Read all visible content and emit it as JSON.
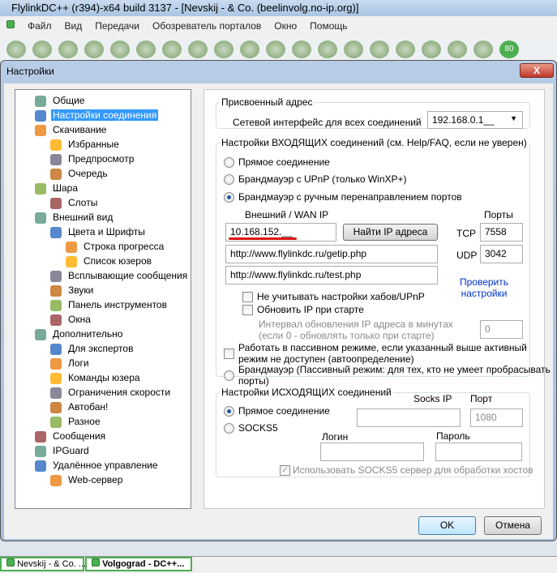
{
  "window": {
    "title": "FlylinkDC++ (r394)-x64 build 3137 - [Nevskij - & Co. (beelinvolg.no-ip.org)]"
  },
  "menu": [
    "Файл",
    "Вид",
    "Передачи",
    "Обозреватель порталов",
    "Окно",
    "Помощь"
  ],
  "toolbar_badge": "80",
  "dialog": {
    "title": "Настройки",
    "close": "X",
    "ok": "OK",
    "cancel": "Отмена"
  },
  "tree": [
    {
      "label": "Общие",
      "level": 0
    },
    {
      "label": "Настройки соединения",
      "level": 0,
      "selected": true
    },
    {
      "label": "Скачивание",
      "level": 0
    },
    {
      "label": "Избранные",
      "level": 1
    },
    {
      "label": "Предпросмотр",
      "level": 1
    },
    {
      "label": "Очередь",
      "level": 1
    },
    {
      "label": "Шара",
      "level": 0
    },
    {
      "label": "Слоты",
      "level": 1
    },
    {
      "label": "Внешний вид",
      "level": 0
    },
    {
      "label": "Цвета и Шрифты",
      "level": 1
    },
    {
      "label": "Строка прогресса",
      "level": 2
    },
    {
      "label": "Список юзеров",
      "level": 2
    },
    {
      "label": "Всплывающие сообщения",
      "level": 1
    },
    {
      "label": "Звуки",
      "level": 1
    },
    {
      "label": "Панель инструментов",
      "level": 1
    },
    {
      "label": "Окна",
      "level": 1
    },
    {
      "label": "Дополнительно",
      "level": 0
    },
    {
      "label": "Для экспертов",
      "level": 1
    },
    {
      "label": "Логи",
      "level": 1
    },
    {
      "label": "Команды юзера",
      "level": 1
    },
    {
      "label": "Ограничения скорости",
      "level": 1
    },
    {
      "label": "Автобан!",
      "level": 1
    },
    {
      "label": "Разное",
      "level": 1
    },
    {
      "label": "Сообщения",
      "level": 0
    },
    {
      "label": "IPGuard",
      "level": 0
    },
    {
      "label": "Удалённое управление",
      "level": 0
    },
    {
      "label": "Web-сервер",
      "level": 1
    }
  ],
  "assigned": {
    "legend": "Присвоенный адрес",
    "label": "Сетевой интерфейс для всех соединений",
    "value": "192.168.0.1__"
  },
  "incoming": {
    "legend": "Настройки ВХОДЯЩИХ соединений (см. Help/FAQ, если не уверен)",
    "radio_direct": "Прямое соединение",
    "radio_upnp": "Брандмауэр с UPnP (только WinXP+)",
    "radio_manual": "Брандмауэр с ручным перенаправлением портов",
    "wan_label": "Внешний / WAN IP",
    "wan_value": "10.168.152.__",
    "find_ip": "Найти IP адреса",
    "ports_label": "Порты",
    "tcp_label": "TCP",
    "tcp": "7558",
    "udp_label": "UDP",
    "udp": "3042",
    "getip_url": "http://www.flylinkdc.ru/getip.php",
    "test_url": "http://www.flylinkdc.ru/test.php",
    "check_link": "Проверить настройки",
    "cb_ignore_hubs": "Не учитывать настройки хабов/UPnP",
    "cb_update_ip": "Обновить IP при старте",
    "interval_label1": "Интервал обновления IP адреса в минутах",
    "interval_label2": "(если 0 - обновлять только при старте)",
    "interval": "0",
    "cb_passive1": "Работать в пассивном режиме, если указанный выше активный",
    "cb_passive2": "режим не доступен (автоопределение)",
    "radio_passive1": "Брандмауэр (Пассивный режим: для тех, кто не умеет пробрасывать",
    "radio_passive2": "порты)"
  },
  "outgoing": {
    "legend": "Настройки ИСХОДЯЩИХ соединений",
    "radio_direct": "Прямое соединение",
    "radio_socks": "SOCKS5",
    "socks_ip_label": "Socks IP",
    "port_label": "Порт",
    "port": "1080",
    "login_label": "Логин",
    "password_label": "Пароль",
    "cb_socks_hosts": "Использовать SOCKS5 сервер для обработки хостов"
  },
  "taskbar": [
    "Nevskij - & Co. ...",
    "Volgograd - DC++..."
  ]
}
